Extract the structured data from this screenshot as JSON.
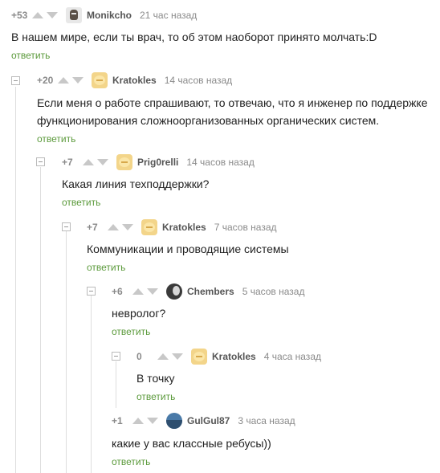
{
  "comments": [
    {
      "rating": "+53",
      "author": "Monikcho",
      "time": "21 час назад",
      "text": "В нашем мире, если ты врач, то об этом наоборот принято молчать:D",
      "reply": "ответить",
      "avatar": "skull-avatar"
    },
    {
      "rating": "+20",
      "author": "Kratokles",
      "time": "14 часов назад",
      "text": "Если меня о работе спрашивают, то отвечаю, что я инженер по поддержке функционирования сложноорганизованных органических систем.",
      "reply": "ответить",
      "avatar": "emoji-avatar"
    },
    {
      "rating": "+7",
      "author": "Prig0relli",
      "time": "14 часов назад",
      "text": "Какая линия техподдержки?",
      "reply": "ответить",
      "avatar": "emoji-avatar"
    },
    {
      "rating": "+7",
      "author": "Kratokles",
      "time": "7 часов назад",
      "text": "Коммуникации и проводящие системы",
      "reply": "ответить",
      "avatar": "emoji-avatar"
    },
    {
      "rating": "+6",
      "author": "Chembers",
      "time": "5 часов назад",
      "text": "невролог?",
      "reply": "ответить",
      "avatar": "dark-avatar"
    },
    {
      "rating": "0",
      "author": "Kratokles",
      "time": "4 часа назад",
      "text": "В точку",
      "reply": "ответить",
      "avatar": "emoji-avatar"
    },
    {
      "rating": "+1",
      "author": "GulGul87",
      "time": "3 часа назад",
      "text": "какие у вас классные ребусы))",
      "reply": "ответить",
      "avatar": "landscape-avatar"
    }
  ],
  "colors": {
    "reply_link": "#5b9a3b",
    "rating": "#8a8a8a",
    "author": "#555555"
  }
}
